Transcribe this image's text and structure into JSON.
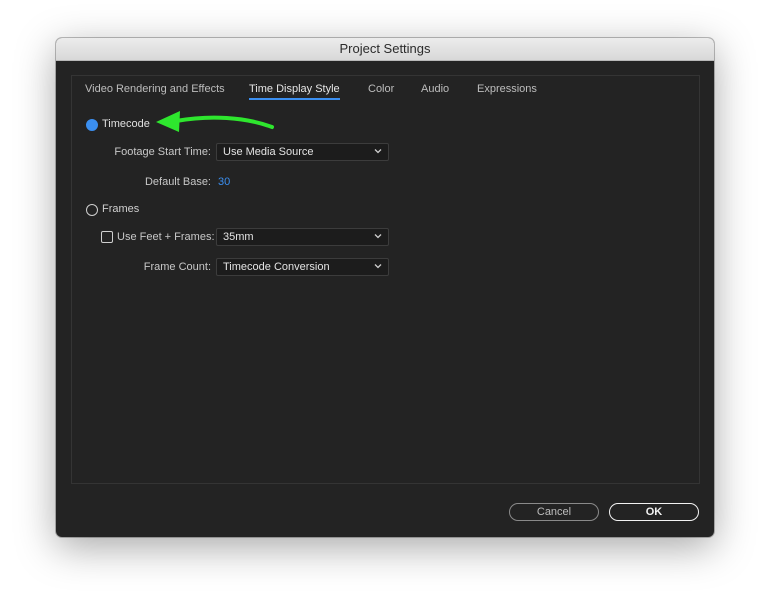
{
  "window": {
    "title": "Project Settings"
  },
  "tabs": [
    {
      "label": "Video Rendering and Effects"
    },
    {
      "label": "Time Display Style"
    },
    {
      "label": "Color"
    },
    {
      "label": "Audio"
    },
    {
      "label": "Expressions"
    }
  ],
  "active_tab": "Time Display Style",
  "timecode": {
    "label": "Timecode",
    "selected": true,
    "footage_start_time": {
      "label": "Footage Start Time:",
      "value": "Use Media Source"
    },
    "default_base": {
      "label": "Default Base:",
      "value": "30"
    }
  },
  "frames": {
    "label": "Frames",
    "selected": false,
    "use_feet_frames": {
      "label": "Use Feet + Frames:",
      "checked": false,
      "value": "35mm"
    },
    "frame_count": {
      "label": "Frame Count:",
      "value": "Timecode Conversion"
    }
  },
  "buttons": {
    "cancel": "Cancel",
    "ok": "OK"
  },
  "colors": {
    "accent": "#3b8ff0",
    "annotation_arrow": "#2ee62e",
    "background": "#232323"
  },
  "annotation": {
    "icon": "arrow-left-icon"
  }
}
